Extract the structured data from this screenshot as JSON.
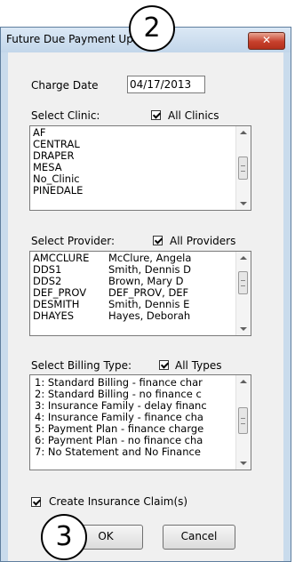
{
  "window": {
    "title": "Future Due Payment Update",
    "close_glyph": "✕"
  },
  "charge_date": {
    "label": "Charge Date",
    "value": "04/17/2013"
  },
  "clinic": {
    "label": "Select Clinic:",
    "all_label": "All Clinics",
    "all_checked": true,
    "items": [
      "AF",
      "CENTRAL",
      "DRAPER",
      "MESA",
      "No_Clinic",
      "PINEDALE"
    ]
  },
  "provider": {
    "label": "Select Provider:",
    "all_label": "All Providers",
    "all_checked": true,
    "items": [
      {
        "code": "AMCCLURE",
        "name": "McClure, Angela"
      },
      {
        "code": "DDS1",
        "name": "Smith, Dennis D"
      },
      {
        "code": "DDS2",
        "name": "Brown, Mary D"
      },
      {
        "code": "DEF_PROV",
        "name": "DEF_PROV, DEF"
      },
      {
        "code": "DESMITH",
        "name": "Smith, Dennis E"
      },
      {
        "code": "DHAYES",
        "name": "Hayes, Deborah"
      }
    ]
  },
  "billing_type": {
    "label": "Select Billing Type:",
    "all_label": "All Types",
    "all_checked": true,
    "items": [
      "1: Standard Billing - finance char",
      "2: Standard Billing - no finance c",
      "3: Insurance Family - delay financ",
      "4: Insurance Family - finance cha",
      "5: Payment Plan - finance charge",
      "6: Payment Plan - no finance cha",
      "7: No Statement and No Finance"
    ]
  },
  "create_claims": {
    "label": "Create Insurance Claim(s)",
    "checked": true
  },
  "buttons": {
    "ok": "OK",
    "cancel": "Cancel"
  },
  "callouts": {
    "two": "2",
    "three": "3"
  }
}
